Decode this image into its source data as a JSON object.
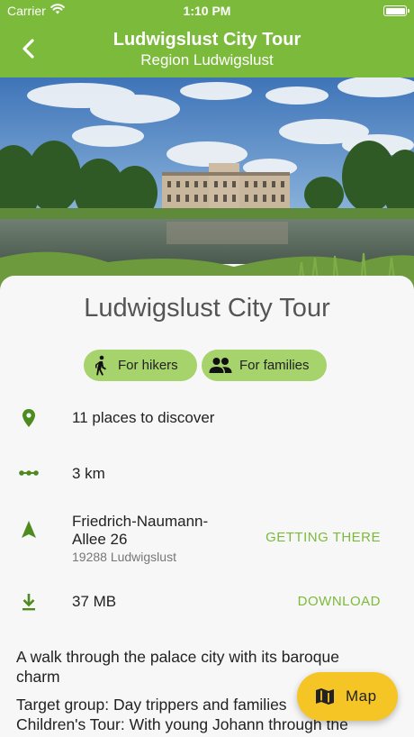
{
  "status_bar": {
    "carrier": "Carrier",
    "time": "1:10 PM"
  },
  "nav": {
    "title": "Ludwigslust City Tour",
    "subtitle": "Region Ludwigslust"
  },
  "tour": {
    "title": "Ludwigslust City Tour",
    "tags": [
      {
        "label": "For hikers",
        "icon": "hiker-icon"
      },
      {
        "label": "For families",
        "icon": "people-icon"
      }
    ]
  },
  "details": {
    "places": "11 places to discover",
    "distance": "3 km",
    "address_line1": "Friedrich-Naumann-",
    "address_line2": "Allee  26",
    "address_city": "19288 Ludwigslust",
    "getting_there": "GETTING THERE",
    "size": "37 MB",
    "download": "DOWNLOAD"
  },
  "description": {
    "p1_line1": "A walk through the palace city with its baroque",
    "p1_line2": "charm",
    "p2_line1": "Target group: Day trippers and families",
    "p2_line2": "Children's Tour: With young Johann through the"
  },
  "fab": {
    "label": "Map",
    "icon": "map-icon"
  },
  "colors": {
    "brand": "#7cba3c",
    "chip": "#a6d36b",
    "fab": "#f5c526",
    "icon": "#4d8a1f"
  }
}
